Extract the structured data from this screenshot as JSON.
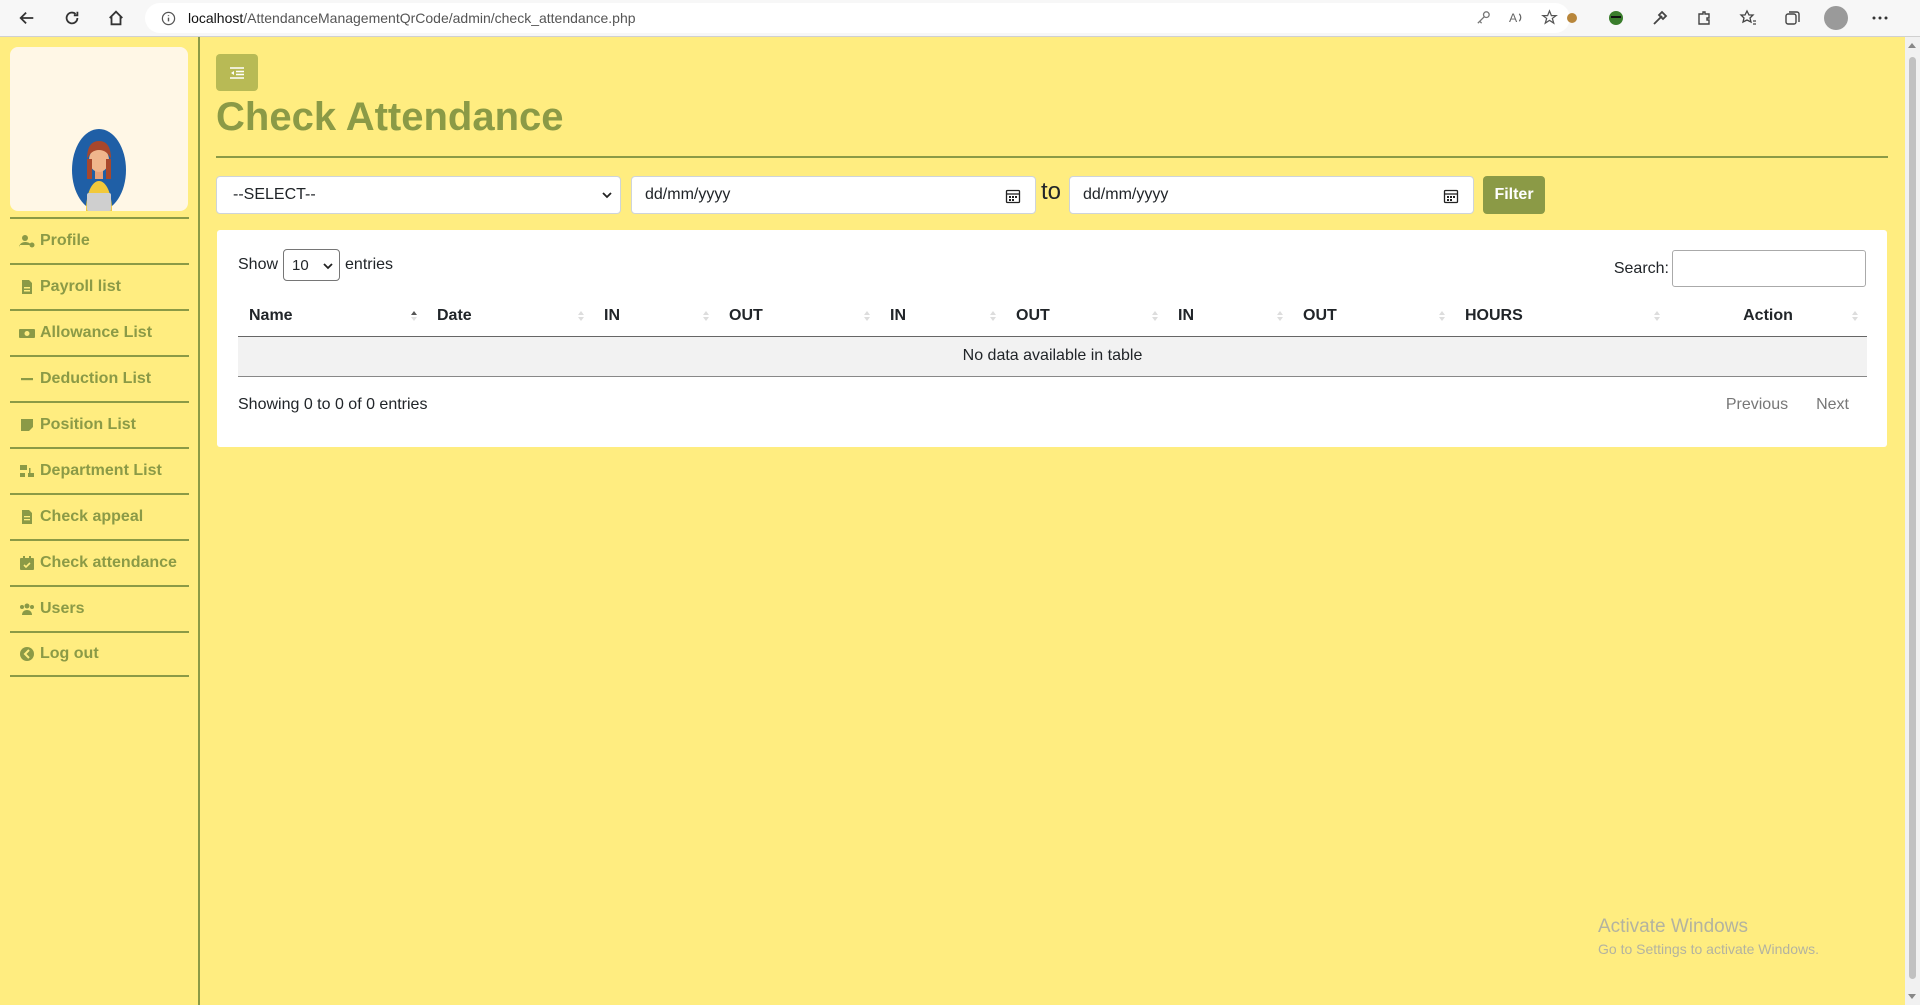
{
  "browser": {
    "url_host": "localhost",
    "url_path": "/AttendanceManagementQrCode/admin/check_attendance.php"
  },
  "sidebar": {
    "items": [
      {
        "label": "Profile",
        "icon": "user-gear-icon"
      },
      {
        "label": "Payroll list",
        "icon": "file-invoice-icon"
      },
      {
        "label": "Allowance List",
        "icon": "money-bill-icon"
      },
      {
        "label": "Deduction List",
        "icon": "minus-icon"
      },
      {
        "label": "Position List",
        "icon": "sticky-note-icon"
      },
      {
        "label": "Department List",
        "icon": "sitemap-icon"
      },
      {
        "label": "Check appeal",
        "icon": "file-alt-icon"
      },
      {
        "label": "Check attendance",
        "icon": "calendar-check-icon"
      },
      {
        "label": "Users",
        "icon": "users-icon"
      },
      {
        "label": "Log out",
        "icon": "arrow-circle-left-icon"
      }
    ]
  },
  "main": {
    "title": "Check Attendance",
    "filter": {
      "select_value": "--SELECT--",
      "date_from_placeholder": "dd/mm/yyyy",
      "to_label": "to",
      "date_to_placeholder": "dd/mm/yyyy",
      "button_label": "Filter"
    },
    "table": {
      "show_label": "Show",
      "length_value": "10",
      "entries_label": "entries",
      "search_label": "Search:",
      "columns": [
        "Name",
        "Date",
        "IN",
        "OUT",
        "IN",
        "OUT",
        "IN",
        "OUT",
        "HOURS",
        "Action"
      ],
      "empty_message": "No data available in table",
      "info": "Showing 0 to 0 of 0 entries",
      "prev_label": "Previous",
      "next_label": "Next"
    }
  },
  "watermark": {
    "line1": "Activate Windows",
    "line2": "Go to Settings to activate Windows."
  },
  "colors": {
    "background": "#ffed80",
    "accent": "#8b9a46",
    "toggle": "#b8ba55"
  }
}
